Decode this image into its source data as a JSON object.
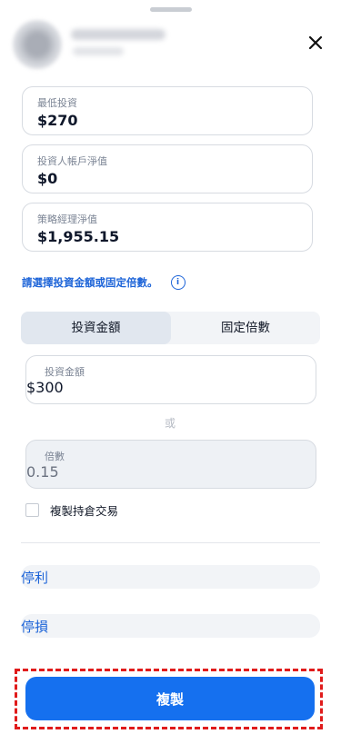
{
  "header": {
    "close_icon": "close-icon"
  },
  "info": [
    {
      "label": "最低投資",
      "value": "$270"
    },
    {
      "label": "投資人帳戶淨值",
      "value": "$0"
    },
    {
      "label": "策略經理淨值",
      "value": "$1,955.15"
    }
  ],
  "hint": {
    "text": "請選擇投資金額或固定倍數。",
    "icon": "info-icon"
  },
  "tabs": [
    {
      "label": "投資金額",
      "active": true
    },
    {
      "label": "固定倍數",
      "active": false
    }
  ],
  "amount": {
    "label": "投資金額",
    "value": "$300"
  },
  "or_text": "或",
  "multiplier": {
    "label": "倍數",
    "value": "0.15"
  },
  "copy_open_trades": {
    "label": "複製持倉交易",
    "checked": false
  },
  "take_profit": {
    "label": "停利"
  },
  "stop_loss": {
    "label": "停損"
  },
  "cta": {
    "label": "複製"
  },
  "colors": {
    "accent": "#1570ef",
    "highlight_border": "#e01b1b"
  }
}
